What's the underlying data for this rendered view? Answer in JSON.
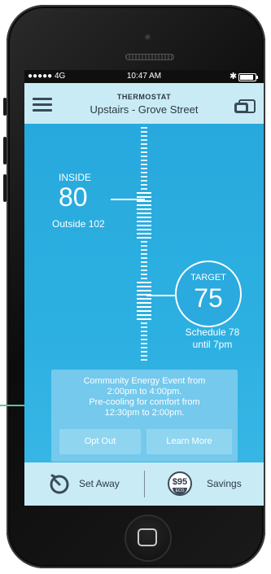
{
  "status_bar": {
    "carrier": "●●●●● 4G",
    "time": "10:47 AM",
    "bluetooth": "✱"
  },
  "header": {
    "title": "THERMOSTAT",
    "location": "Upstairs - Grove Street"
  },
  "inside": {
    "label": "INSIDE",
    "temperature": "80",
    "outside": "Outside 102"
  },
  "target": {
    "label": "TARGET",
    "temperature": "75",
    "schedule_line1": "Schedule 78",
    "schedule_line2": "until 7pm"
  },
  "event": {
    "line1": "Community Energy Event from",
    "line2": "2:00pm to 4:00pm.",
    "line3": "Pre-cooling for comfort from",
    "line4": "12:30pm to 2:00pm.",
    "opt_out_label": "Opt Out",
    "learn_more_label": "Learn More"
  },
  "footer": {
    "set_away_label": "Set Away",
    "savings_amount": "$95",
    "savings_badge_sub": "ECO",
    "savings_label": "Savings"
  },
  "colors": {
    "screen_blue": "#2aaade",
    "header_bg": "#c9ebf5",
    "callout_green": "#5fc0a5",
    "event_card": "#74c9ec"
  }
}
